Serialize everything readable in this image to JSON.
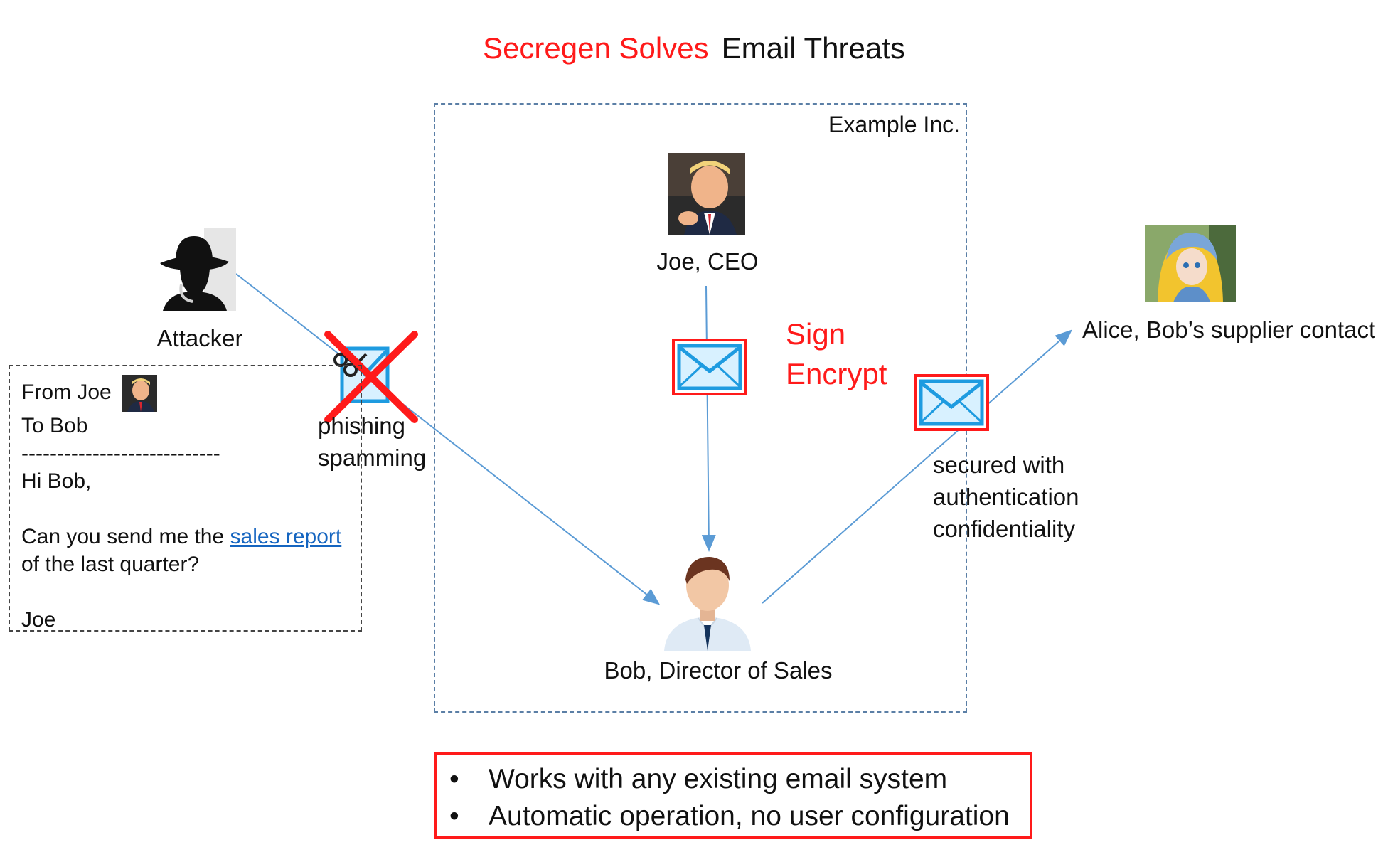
{
  "title": {
    "part1": "Secregen Solves",
    "part2": "Email Threats"
  },
  "company": {
    "label": "Example Inc."
  },
  "people": {
    "ceo": "Joe, CEO",
    "attacker": "Attacker",
    "bob": "Bob, Director of Sales",
    "alice": "Alice, Bob’s supplier contact"
  },
  "actions": {
    "sign": "Sign",
    "encrypt": "Encrypt"
  },
  "threat_labels": {
    "phishing": "phishing",
    "spamming": "spamming"
  },
  "secured_labels": {
    "line1": "secured with",
    "line2": "authentication",
    "line3": "confidentiality"
  },
  "fake_email": {
    "from": "From Joe",
    "to": "To Bob",
    "divider": "----------------------------",
    "greeting": "Hi Bob,",
    "body_start": "Can you send me the ",
    "link_text": "sales report",
    "body_end": "of the last quarter?",
    "signoff": "Joe"
  },
  "features": [
    "Works with any existing email system",
    "Automatic operation, no user configuration"
  ],
  "colors": {
    "accent_red": "#ff1a1a",
    "arrow_blue": "#5b9bd5",
    "envelope_blue": "#1e9be0",
    "link_blue": "#1565c0"
  },
  "icons": [
    "envelope-icon",
    "attacker-icon",
    "ceo-avatar",
    "bob-avatar",
    "alice-avatar",
    "red-x-icon",
    "scissors-icon"
  ]
}
